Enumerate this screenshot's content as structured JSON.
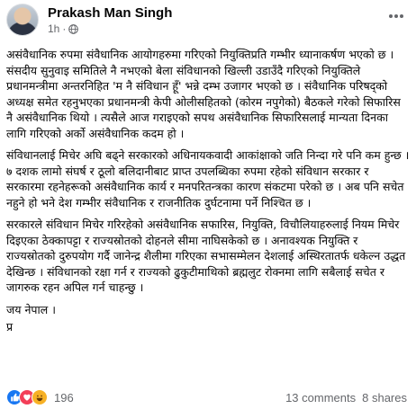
{
  "post": {
    "author": "Prakash Man Singh",
    "timestamp": "1h",
    "separator": "·",
    "paragraphs": [
      "असंवैधानिक रुपमा संवैधानिक आयोगहरुमा गरिएको नियुक्तिप्रति गम्भीर ध्यानाकर्षण भएको छ । संसदीय सुनुवाइ समितिले नै नभएको बेला संविधानको खिल्ली उडाउँदै गरिएको नियुक्तिले प्रधानमन्त्रीमा अन्तरनिहित 'म नै संविधान हूँ' भन्ने दम्भ उजागर भएको छ । संवैधानिक परिषद्को अध्यक्ष समेत रहनुभएका प्रधानमन्त्री केपी ओलीसहितको (कोरम नपुगेको) बैठकले गरेको सिफारिस नै असंवैधानिक थियो । त्यसैले आज गराइएको सपथ असंवैधानिक सिफारिसलाई मान्यता दिनका लागि गरिएको अर्को असंवैधानिक कदम हो ।",
      "संविधानलाई मिचेर अघि बढ्ने सरकारको अधिनायकवादी आकांक्षाको जति निन्दा गरे पनि कम हुन्छ । ७ दशक लामो संघर्ष र ठूलो बलिदानीबाट प्राप्त उपलब्धिका रुपमा रहेको संविधान सरकार र सरकारमा रहनेहरूको असंवैधानिक कार्य र मनपरितन्त्रका कारण संकटमा परेको छ । अब पनि सचेत नहुने हो भने देश गम्भीर संवैधानिक र राजनीतिक दुर्घटनामा पर्ने निश्चित छ ।",
      "सरकारले संविधान मिचेर गरिरहेको असंवैधानिक सफारिस, नियुक्ति, विचौलियाहरुलाई नियम मिचेर दिइएका ठेक्कापट्टा र राज्यस्रोतको दोहनले सीमा नाघिसकेको छ । अनावश्यक नियुक्ति र राज्यस्रोतको दुरुपयोग गर्दै जानेन्द्र शैलीमा गरिएका सभासम्मेलन देशलाई अस्थिरतातर्फ धकेल्न उद्धत देखिन्छ । संविधानको रक्षा गर्न र राज्यको ढुकुटीमाथिको ब्रह्मलुट रोक्नमा लागि सबैलाई सचेत र जागरुक रहन अपिल गर्न चाहन्छु ।",
      "जय नेपाल ।",
      "प्र"
    ]
  },
  "footer": {
    "reaction_icons": [
      "like-icon",
      "love-icon",
      "haha-icon"
    ],
    "reaction_count": "196",
    "comments": "13 comments",
    "shares": "8 shares"
  },
  "colors": {
    "like": "#1877f2",
    "love": "#f33e58",
    "haha": "#f7b125",
    "secondary_text": "#65676b"
  }
}
